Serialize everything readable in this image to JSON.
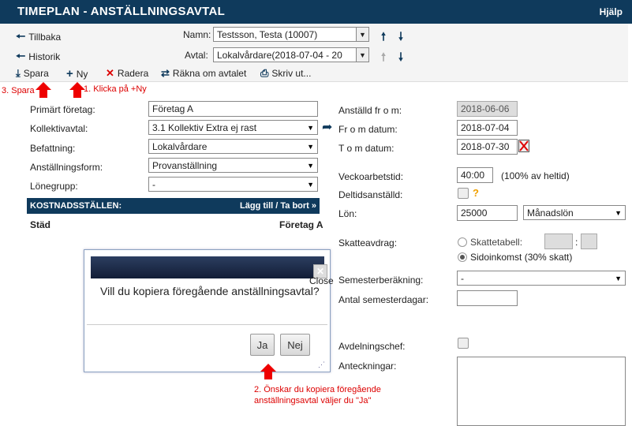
{
  "header": {
    "title": "TIMEPLAN - ANSTÄLLNINGSAVTAL",
    "help": "Hjälp"
  },
  "nav": {
    "back": "Tillbaka",
    "history": "Historik",
    "namn_label": "Namn:",
    "namn_value": "Testsson, Testa (10007)",
    "avtal_label": "Avtal:",
    "avtal_value": "Lokalvårdare(2018-07-04 - 20"
  },
  "toolbar": {
    "save": "Spara",
    "new": "Ny",
    "delete": "Radera",
    "recalc": "Räkna om avtalet",
    "print": "Skriv ut..."
  },
  "annotations": {
    "step1": "1. Klicka på +Ny",
    "step2_line1": "2. Önskar du kopiera föregående",
    "step2_line2": "anställningsavtal väljer du \"Ja\"",
    "step3": "3. Spara"
  },
  "form_left": {
    "primart_label": "Primärt företag:",
    "primart_value": "Företag A",
    "kollektiv_label": "Kollektivavtal:",
    "kollektiv_value": "3.1 Kollektiv Extra ej rast",
    "befattning_label": "Befattning:",
    "befattning_value": "Lokalvårdare",
    "anstform_label": "Anställningsform:",
    "anstform_value": "Provanställning",
    "lonegrupp_label": "Lönegrupp:",
    "lonegrupp_value": "-"
  },
  "kostnad": {
    "header": "KOSTNADSSTÄLLEN:",
    "action": "Lägg till / Ta bort »",
    "row_name": "Städ",
    "row_company": "Företag A"
  },
  "form_right": {
    "anstalld_label": "Anställd fr o m:",
    "anstalld_value": "2018-06-06",
    "from_label": "Fr o m datum:",
    "from_value": "2018-07-04",
    "tom_label": "T o m datum:",
    "tom_value": "2018-07-30",
    "vecko_label": "Veckoarbetstid:",
    "vecko_value": "40:00",
    "vecko_note": "(100% av heltid)",
    "deltid_label": "Deltidsanställd:",
    "deltid_help": "?",
    "lon_label": "Lön:",
    "lon_value": "25000",
    "lon_type": "Månadslön",
    "skatt_label": "Skatteavdrag:",
    "skatt_opt1": "Skattetabell:",
    "skatt_sep": ":",
    "skatt_opt2": "Sidoinkomst (30% skatt)",
    "semester_label": "Semesterberäkning:",
    "semester_value": "-",
    "semdagar_label": "Antal semesterdagar:",
    "avdchef_label": "Avdelningschef:",
    "anteck_label": "Anteckningar:"
  },
  "dialog": {
    "message": "Vill du kopiera föregående anställningsavtal?",
    "close_text": "Close",
    "close_x": "✕",
    "yes": "Ja",
    "no": "Nej"
  },
  "colors": {
    "primary": "#0f3a5c",
    "annotation": "#dd0000"
  }
}
